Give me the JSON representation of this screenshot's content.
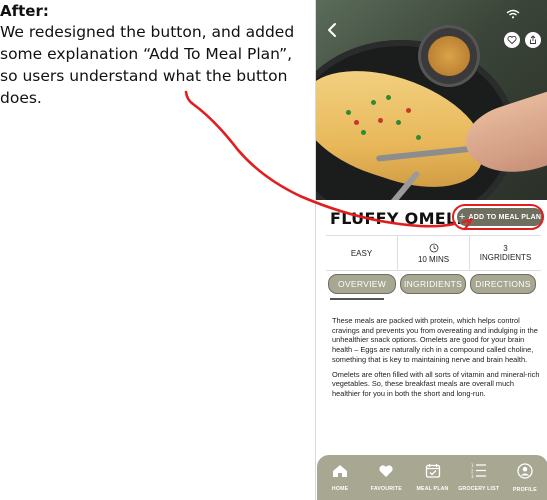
{
  "annotation": {
    "title": "After:",
    "body": "We redesigned the button, and added some explanation “Add To Meal Plan”, so users understand what the button does.",
    "highlight_color": "#e11d1d"
  },
  "recipe": {
    "title": "FLUFFY OMELET",
    "add_button": {
      "icon": "plus-icon",
      "label": "ADD TO MEAL PLAN"
    },
    "info": {
      "difficulty": "EASY",
      "time": "10 MINS",
      "time_icon": "clock-icon",
      "ingredients_count": "3",
      "ingredients_label": "INGRIDIENTS"
    },
    "tabs": [
      {
        "label": "OVERVIEW",
        "active": true
      },
      {
        "label": "INGRIDIENTS",
        "active": false
      },
      {
        "label": "DIRECTIONS",
        "active": false
      }
    ],
    "paragraphs": [
      "These meals are packed with protein, which helps control cravings and prevents you from overeating and indulging in the unhealthier snack options. Omelets are good for your brain health – Eggs are naturally rich in a compound called choline, something that is key to maintaining nerve and brain health.",
      "Omelets are often filled with all sorts of vitamin and mineral-rich vegetables. So, these breakfast meals are overall much healthier for you in both the short and long-run."
    ]
  },
  "header_icons": {
    "back": "chevron-left-icon",
    "favourite": "heart-icon",
    "share": "share-icon"
  },
  "bottom_nav": [
    {
      "label": "HOME",
      "icon": "home-icon"
    },
    {
      "label": "FAVOURITE",
      "icon": "heart-icon"
    },
    {
      "label": "MEAL PLAN",
      "icon": "calendar-check-icon"
    },
    {
      "label": "GROCERY LIST",
      "icon": "list-icon"
    },
    {
      "label": "PROFILE",
      "icon": "user-icon"
    }
  ],
  "colors": {
    "accent": "#6f6f60",
    "tab_bg": "#a7a792",
    "nav_bg": "#a7a792"
  }
}
